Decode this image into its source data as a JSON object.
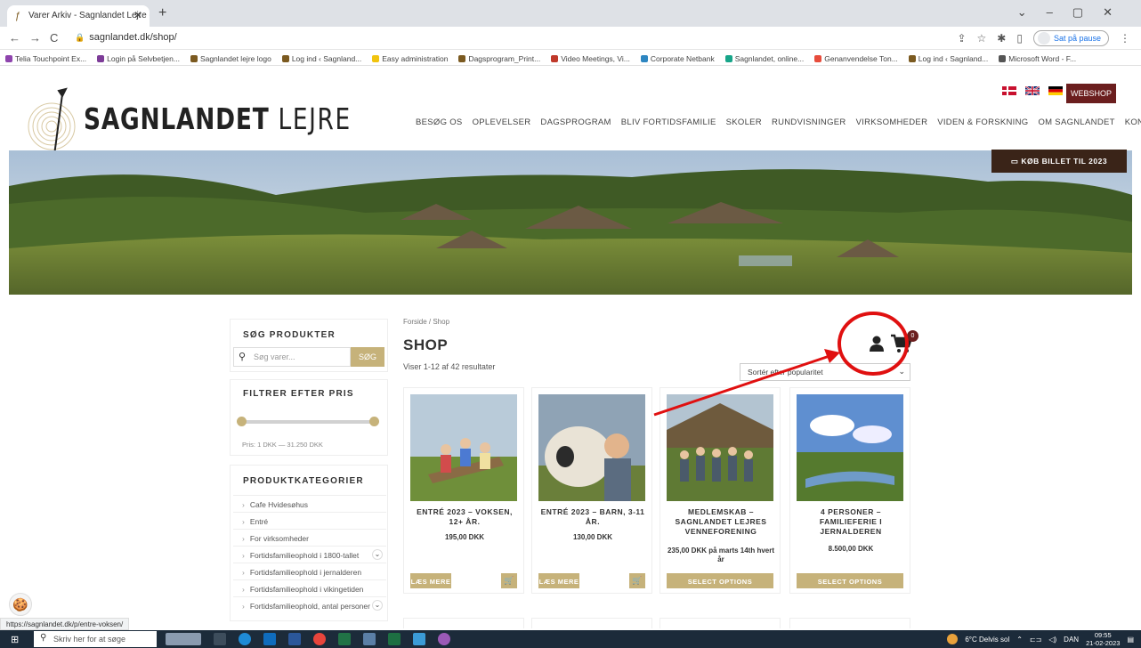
{
  "browser": {
    "tab_title": "Varer Arkiv - Sagnlandet Lejre - F",
    "url": "sagnlandet.dk/shop/",
    "profile_label": "Sat på pause",
    "bookmarks": [
      {
        "label": "Telia Touchpoint Ex...",
        "color": "#8e44ad"
      },
      {
        "label": "Login på Selvbetjen...",
        "color": "#7d3c98"
      },
      {
        "label": "Sagnlandet lejre logo",
        "color": "#7b5a20"
      },
      {
        "label": "Log ind ‹ Sagnland...",
        "color": "#7b5a20"
      },
      {
        "label": "Easy administration",
        "color": "#f1c40f"
      },
      {
        "label": "Dagsprogram_Print...",
        "color": "#7b5a20"
      },
      {
        "label": "Video Meetings, Vi...",
        "color": "#c0392b"
      },
      {
        "label": "Corporate Netbank",
        "color": "#2e86c1"
      },
      {
        "label": "Sagnlandet, online...",
        "color": "#17a589"
      },
      {
        "label": "Genanvendelse Ton...",
        "color": "#e74c3c"
      },
      {
        "label": "Log ind ‹ Sagnland...",
        "color": "#7b5a20"
      },
      {
        "label": "Microsoft Word - F...",
        "color": "#555555"
      }
    ],
    "status_url": "https://sagnlandet.dk/p/entre-voksen/"
  },
  "header": {
    "logo_bold": "SAGNLANDET",
    "logo_thin": "LEJRE",
    "webshop_label": "WEBSHOP",
    "nav": [
      "BESØG OS",
      "OPLEVELSER",
      "DAGSPROGRAM",
      "BLIV FORTIDSFAMILIE",
      "SKOLER",
      "RUNDVISNINGER",
      "VIRKSOMHEDER",
      "VIDEN & FORSKNING",
      "OM SAGNLANDET",
      "KONTAKT"
    ],
    "buy_ticket": "KØB BILLET TIL 2023"
  },
  "sidebar": {
    "search_title": "SØG PRODUKTER",
    "search_placeholder": "Søg varer...",
    "search_button": "SØG",
    "price_title": "FILTRER EFTER PRIS",
    "price_range": "Pris: 1 DKK — 31.250 DKK",
    "categories_title": "PRODUKTKATEGORIER",
    "categories": [
      {
        "label": "Cafe Hvidesøhus",
        "expandable": false
      },
      {
        "label": "Entré",
        "expandable": false
      },
      {
        "label": "For virksomheder",
        "expandable": false
      },
      {
        "label": "Fortidsfamilieophold i 1800-tallet",
        "expandable": true
      },
      {
        "label": "Fortidsfamilieophold i jernalderen",
        "expandable": false
      },
      {
        "label": "Fortidsfamilieophold i vikingetiden",
        "expandable": false
      },
      {
        "label": "Fortidsfamilieophold, antal personer",
        "expandable": true
      }
    ]
  },
  "shop": {
    "breadcrumb": "Forside / Shop",
    "title": "SHOP",
    "results": "Viser 1-12 af 42 resultater",
    "sort_selected": "Sortér efter popularitet",
    "cart_count": "0",
    "products": [
      {
        "name": "ENTRÉ 2023 – VOKSEN, 12+ ÅR.",
        "price": "195,00 DKK",
        "button": "LÆS MERE",
        "has_cart": true
      },
      {
        "name": "ENTRÉ 2023 – BARN, 3-11 ÅR.",
        "price": "130,00 DKK",
        "button": "LÆS MERE",
        "has_cart": true
      },
      {
        "name": "MEDLEMSKAB – SAGNLANDET LEJRES VENNEFORENING",
        "price": "235,00 DKK på marts 14th hvert år",
        "button": "SELECT OPTIONS",
        "has_cart": false
      },
      {
        "name": "4 PERSONER – FAMILIEFERIE I JERNALDEREN",
        "price": "8.500,00 DKK",
        "button": "SELECT OPTIONS",
        "has_cart": false
      }
    ]
  },
  "taskbar": {
    "search_placeholder": "Skriv her for at søge",
    "weather": "6°C Delvis sol",
    "lang": "DAN",
    "time": "09:55",
    "date": "21-02-2023"
  },
  "colors": {
    "accent_gold": "#c6b27a",
    "brand_maroon": "#6b1e1e",
    "annotation_red": "#e01010"
  }
}
